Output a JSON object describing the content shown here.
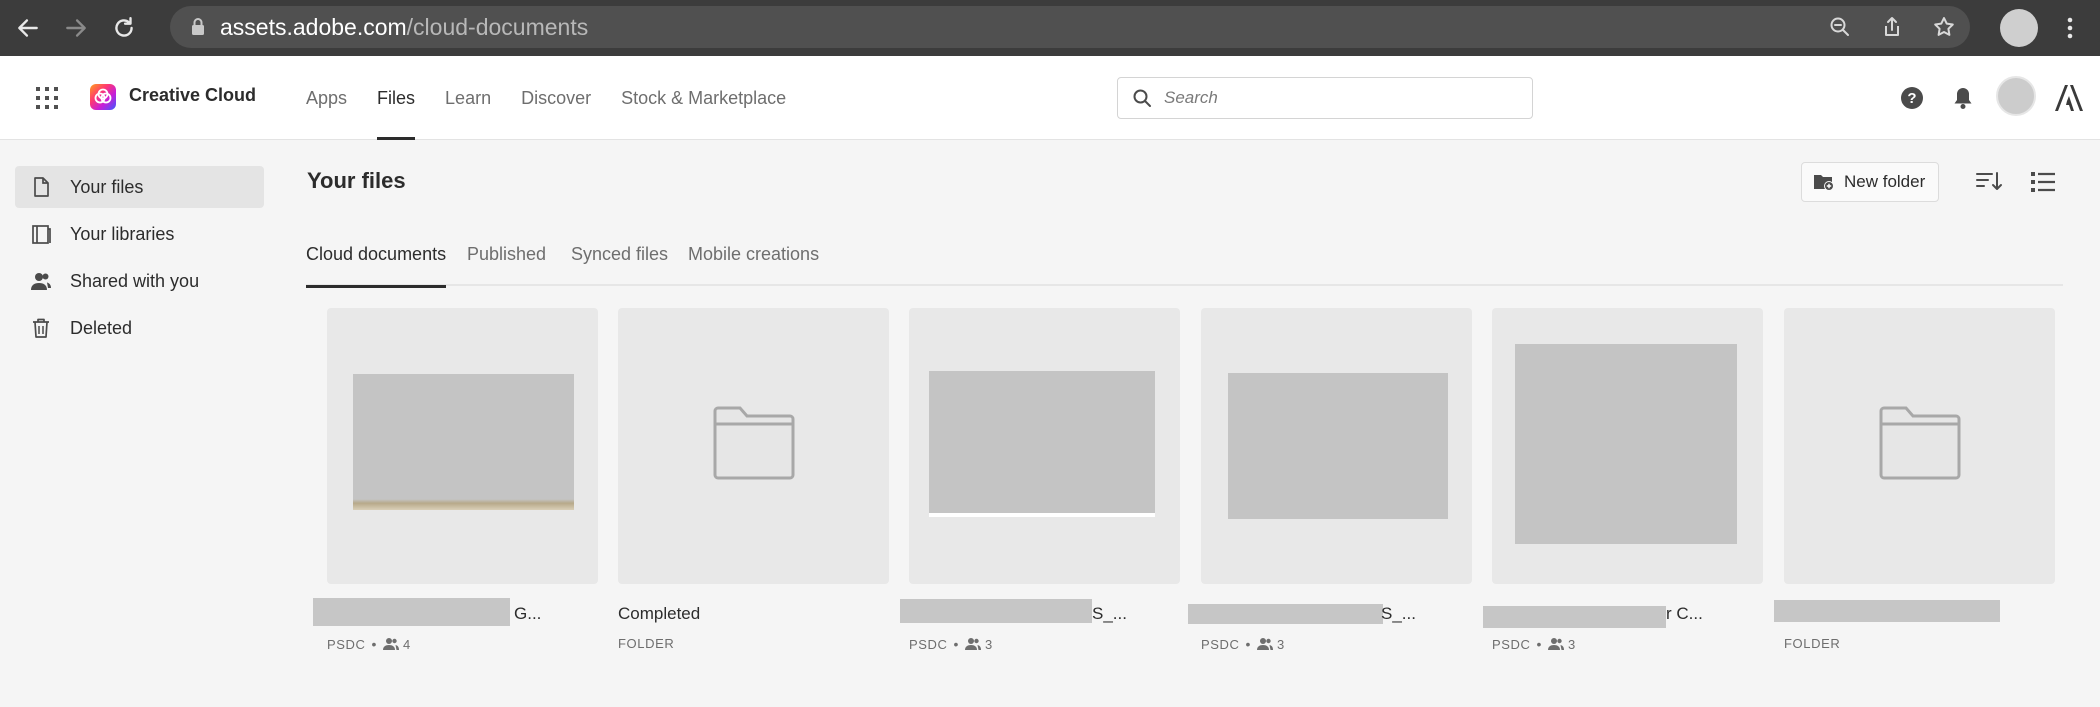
{
  "browser": {
    "url_host": "assets.adobe.com",
    "url_path": "/cloud-documents",
    "icons": [
      "back-icon",
      "forward-icon",
      "reload-icon",
      "lock-icon",
      "zoom-icon",
      "share-icon",
      "star-icon",
      "profile-avatar",
      "chrome-menu-icon"
    ]
  },
  "header": {
    "brand": "Creative Cloud",
    "nav": [
      {
        "label": "Apps",
        "active": false
      },
      {
        "label": "Files",
        "active": true
      },
      {
        "label": "Learn",
        "active": false
      },
      {
        "label": "Discover",
        "active": false
      },
      {
        "label": "Stock & Marketplace",
        "active": false
      }
    ],
    "search_placeholder": "Search"
  },
  "sidebar": {
    "items": [
      {
        "label": "Your files",
        "icon": "file-icon",
        "active": true
      },
      {
        "label": "Your libraries",
        "icon": "libraries-icon",
        "active": false
      },
      {
        "label": "Shared with you",
        "icon": "people-icon",
        "active": false
      },
      {
        "label": "Deleted",
        "icon": "trash-icon",
        "active": false
      }
    ]
  },
  "main": {
    "title": "Your files",
    "new_folder_label": "New folder",
    "tabs": [
      {
        "label": "Cloud documents",
        "active": true
      },
      {
        "label": "Published",
        "active": false
      },
      {
        "label": "Synced files",
        "active": false
      },
      {
        "label": "Mobile creations",
        "active": false
      }
    ],
    "cards": [
      {
        "name": "G...",
        "kind": "PSDC",
        "shared": "4"
      },
      {
        "name": "Completed",
        "kind": "FOLDER",
        "shared": ""
      },
      {
        "name": "S_...",
        "kind": "PSDC",
        "shared": "3"
      },
      {
        "name": "S_...",
        "kind": "PSDC",
        "shared": "3"
      },
      {
        "name": "r C...",
        "kind": "PSDC",
        "shared": "3"
      },
      {
        "name": "",
        "kind": "FOLDER",
        "shared": ""
      }
    ]
  },
  "colors": {
    "chrome_bg": "#3c3c3c",
    "omnibox_bg": "#505050",
    "page_bg": "#f5f5f5",
    "active_underline": "#2c2c2c"
  }
}
